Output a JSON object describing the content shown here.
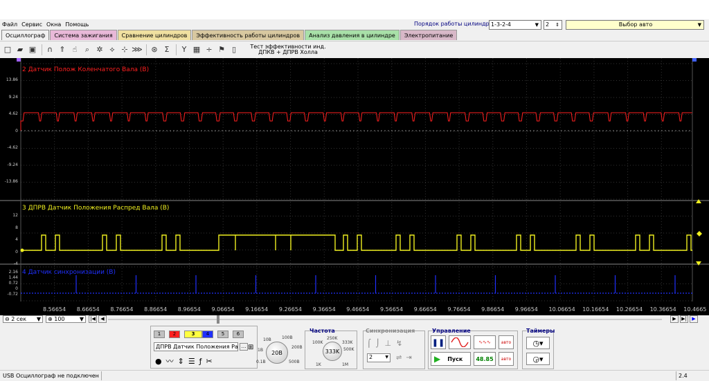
{
  "menu": [
    "Файл",
    "Сервис",
    "Окна",
    "Помощь"
  ],
  "header": {
    "cylinder_order_label": "Порядок работы цилиндров",
    "cylinder_order_value": "1-3-2-4",
    "cylinder_number_value": "2",
    "auto_select_label": "Выбор авто"
  },
  "tabs": [
    {
      "label": "Осциллограф",
      "color": "#f0f0f0"
    },
    {
      "label": "Система зажигания",
      "color": "#e8b8d8"
    },
    {
      "label": "Сравнение цилиндров",
      "color": "#f0e0a0"
    },
    {
      "label": "Эффективность работы цилиндров",
      "color": "#d8c8a0"
    },
    {
      "label": "Анализ давления в цилиндре",
      "color": "#a8e0a8"
    },
    {
      "label": "Электропитание",
      "color": "#d8b8c8"
    }
  ],
  "toolbar": {
    "test_combo": "Тест эффективности инд. ДПКВ + ДПРВ Холла",
    "icons": [
      "new-file-icon",
      "open-folder-icon",
      "save-icon",
      "zoom-wave-icon",
      "zoom-vertical-icon",
      "hand-pan-icon",
      "magnifier-icon",
      "filter-icon",
      "trigger-icon",
      "cursor-icon",
      "measure-icon",
      "auto-icon",
      "sigma-icon",
      "channel-setup-icon",
      "table-icon",
      "divider-icon",
      "marker-icon",
      "page-icon"
    ]
  },
  "channels": {
    "ch2": {
      "title": "2 Датчик Полож Коленчатого Вала (В)",
      "color": "#ff2020",
      "ticks": [
        "13.86",
        "9.24",
        "4.62",
        "0",
        "-4.62",
        "-9.24",
        "-13.86"
      ]
    },
    "ch3": {
      "title": "3 ДПРВ Датчик Положения Распред Вала (В)",
      "color": "#f0f020",
      "ticks": [
        "12",
        "8",
        "4",
        "0",
        "-4"
      ]
    },
    "ch4": {
      "title": "4 Датчик синхронизации (В)",
      "color": "#2030ff",
      "ticks": [
        "2.16",
        "1.44",
        "0.72",
        "0",
        "-0.72"
      ]
    }
  },
  "xaxis": [
    "8.56654",
    "8.66654",
    "8.76654",
    "8.86654",
    "8.96654",
    "9.06654",
    "9.16654",
    "9.26654",
    "9.36654",
    "9.46654",
    "9.56654",
    "9.66654",
    "9.76654",
    "9.86654",
    "9.96654",
    "10.06654",
    "10.16654",
    "10.26654",
    "10.36654",
    "10.4665"
  ],
  "timebase": {
    "value": "2 сек",
    "percent": "100"
  },
  "channel_buttons": [
    "1",
    "2",
    "3",
    "4",
    "5",
    "6"
  ],
  "channel_colors": [
    "#c0c0c0",
    "#ff2020",
    "#ffff40",
    "#2030ff",
    "#c0c0c0",
    "#c0c0c0"
  ],
  "channel_name_combo": "ДПРВ Датчик Положения Рас",
  "voltage_knob": {
    "value": "20В",
    "labels": [
      "10В",
      "100В",
      "1В",
      "200В",
      "0.1В",
      "500В"
    ]
  },
  "frequency": {
    "title": "Частота",
    "value": "333K",
    "labels": [
      "250K",
      "100K",
      "333K",
      "500K",
      "1K",
      "1M"
    ]
  },
  "sync": {
    "title": "Синхронизация",
    "value": "2"
  },
  "control": {
    "title": "Управление",
    "start_label": "Пуск",
    "freq_value": "48.85",
    "auto_label": "авто"
  },
  "timers": {
    "title": "Таймеры"
  },
  "status": {
    "text": "USB Осциллограф не подключен",
    "value": "2.4"
  }
}
